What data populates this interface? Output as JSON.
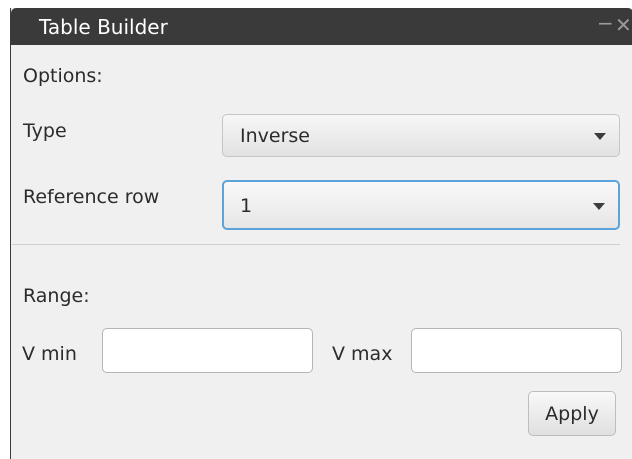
{
  "window": {
    "title": "Table Builder",
    "minimize_glyph": "−",
    "close_glyph": "✕"
  },
  "options": {
    "heading": "Options:",
    "type_label": "Type",
    "type_value": "Inverse",
    "reference_row_label": "Reference row",
    "reference_row_value": "1"
  },
  "range": {
    "heading": "Range:",
    "vmin_label": "V min",
    "vmin_value": "",
    "vmax_label": "V max",
    "vmax_value": ""
  },
  "actions": {
    "apply_label": "Apply"
  },
  "colors": {
    "titlebar": "#3a3a3a",
    "panel": "#f0f0f0",
    "focus_border": "#5ba3d8"
  }
}
